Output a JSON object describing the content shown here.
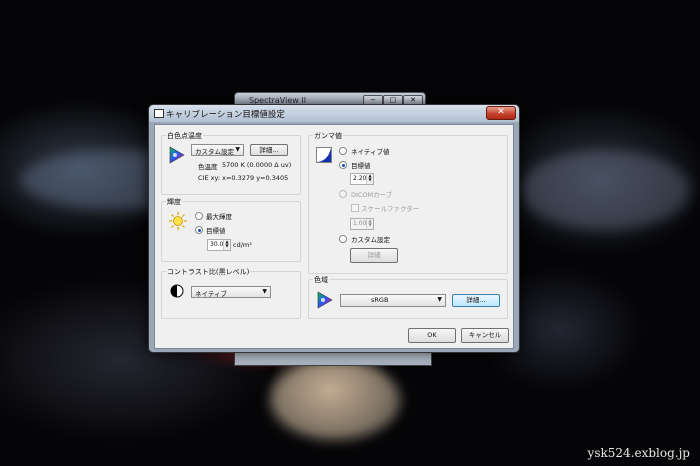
{
  "background": {
    "watermark": "ysk524.exblog.jp"
  },
  "behind_window": {
    "title": "SpectraView II",
    "buttons": [
      "−",
      "□",
      "✕"
    ]
  },
  "dialog": {
    "title": "キャリブレーション目標値設定",
    "close": "✕",
    "white_point": {
      "label": "白色点温度",
      "preset": "カスタム設定",
      "detail_button": "詳細...",
      "temp_label": "色温度",
      "temp_value": "5700 K (0.0000 Δ uv)",
      "cie": "CIE xy: x=0.3279 y=0.3405",
      "icon": "color-gamut-icon"
    },
    "luminance": {
      "label": "輝度",
      "opt_max": "最大輝度",
      "opt_target": "目標値",
      "value": "30.0",
      "unit": "cd/m²",
      "icon": "sun-icon"
    },
    "contrast": {
      "label": "コントラスト比(黒レベル)",
      "preset": "ネイティブ",
      "icon": "half-circle-icon"
    },
    "gamma": {
      "label": "ガンマ値",
      "opt_native": "ネイティブ値",
      "opt_target": "目標値",
      "value": "2.20",
      "opt_dicom": "DICOMカーブ",
      "scale_factor": "スケールファクター",
      "scale_value": "1.00",
      "opt_custom": "カスタム設定",
      "custom_button": "詳細",
      "icon": "gamma-curve-icon"
    },
    "color_gamut": {
      "label": "色域",
      "preset": "sRGB",
      "detail_button": "詳細...",
      "icon": "color-gamut-icon"
    },
    "ok": "OK",
    "cancel": "キャンセル"
  }
}
